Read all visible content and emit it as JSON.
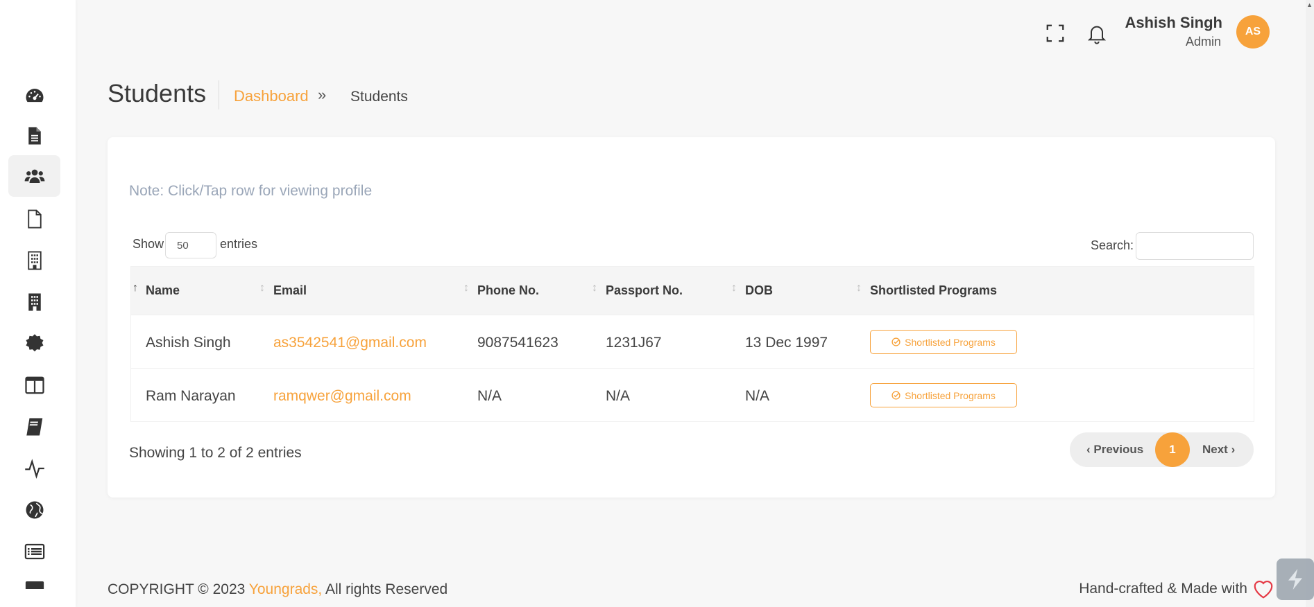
{
  "header": {
    "user_name": "Ashish Singh",
    "user_role": "Admin",
    "avatar_initials": "AS",
    "fullscreen_icon": "fullscreen-icon",
    "bell_icon": "bell-icon"
  },
  "sidebar": {
    "items": [
      {
        "icon": "dashboard-icon"
      },
      {
        "icon": "document-icon"
      },
      {
        "icon": "users-icon",
        "active": true
      },
      {
        "icon": "file-icon"
      },
      {
        "icon": "building-outline-icon"
      },
      {
        "icon": "building-icon"
      },
      {
        "icon": "certificate-icon"
      },
      {
        "icon": "columns-icon"
      },
      {
        "icon": "book-icon"
      },
      {
        "icon": "activity-icon"
      },
      {
        "icon": "globe-icon"
      },
      {
        "icon": "list-icon"
      },
      {
        "icon": "card-icon"
      }
    ]
  },
  "page": {
    "title": "Students",
    "breadcrumb_link": "Dashboard",
    "breadcrumb_sep": "»",
    "breadcrumb_current": "Students"
  },
  "card": {
    "note": "Note: Click/Tap row for viewing profile",
    "show_label": "Show",
    "entries_value": "50",
    "entries_label": "entries",
    "search_label": "Search:",
    "search_value": ""
  },
  "table": {
    "columns": [
      "Name",
      "Email",
      "Phone No.",
      "Passport No.",
      "DOB",
      "Shortlisted Programs"
    ],
    "rows": [
      {
        "name": "Ashish Singh",
        "email": "as3542541@gmail.com",
        "phone": "9087541623",
        "passport": "1231J67",
        "dob": "13 Dec 1997",
        "action": "Shortlisted Programs"
      },
      {
        "name": "Ram Narayan",
        "email": "ramqwer@gmail.com",
        "phone": "N/A",
        "passport": "N/A",
        "dob": "N/A",
        "action": "Shortlisted Programs"
      }
    ]
  },
  "pagination": {
    "info": "Showing 1 to 2 of 2 entries",
    "prev": "‹ Previous",
    "current": "1",
    "next": "Next ›"
  },
  "footer": {
    "copyright": "COPYRIGHT © 2023 ",
    "brand": "Youngrads,",
    "rights": " All rights Reserved",
    "right_text": "Hand-crafted & Made with"
  },
  "colors": {
    "accent": "#f7a23b"
  }
}
